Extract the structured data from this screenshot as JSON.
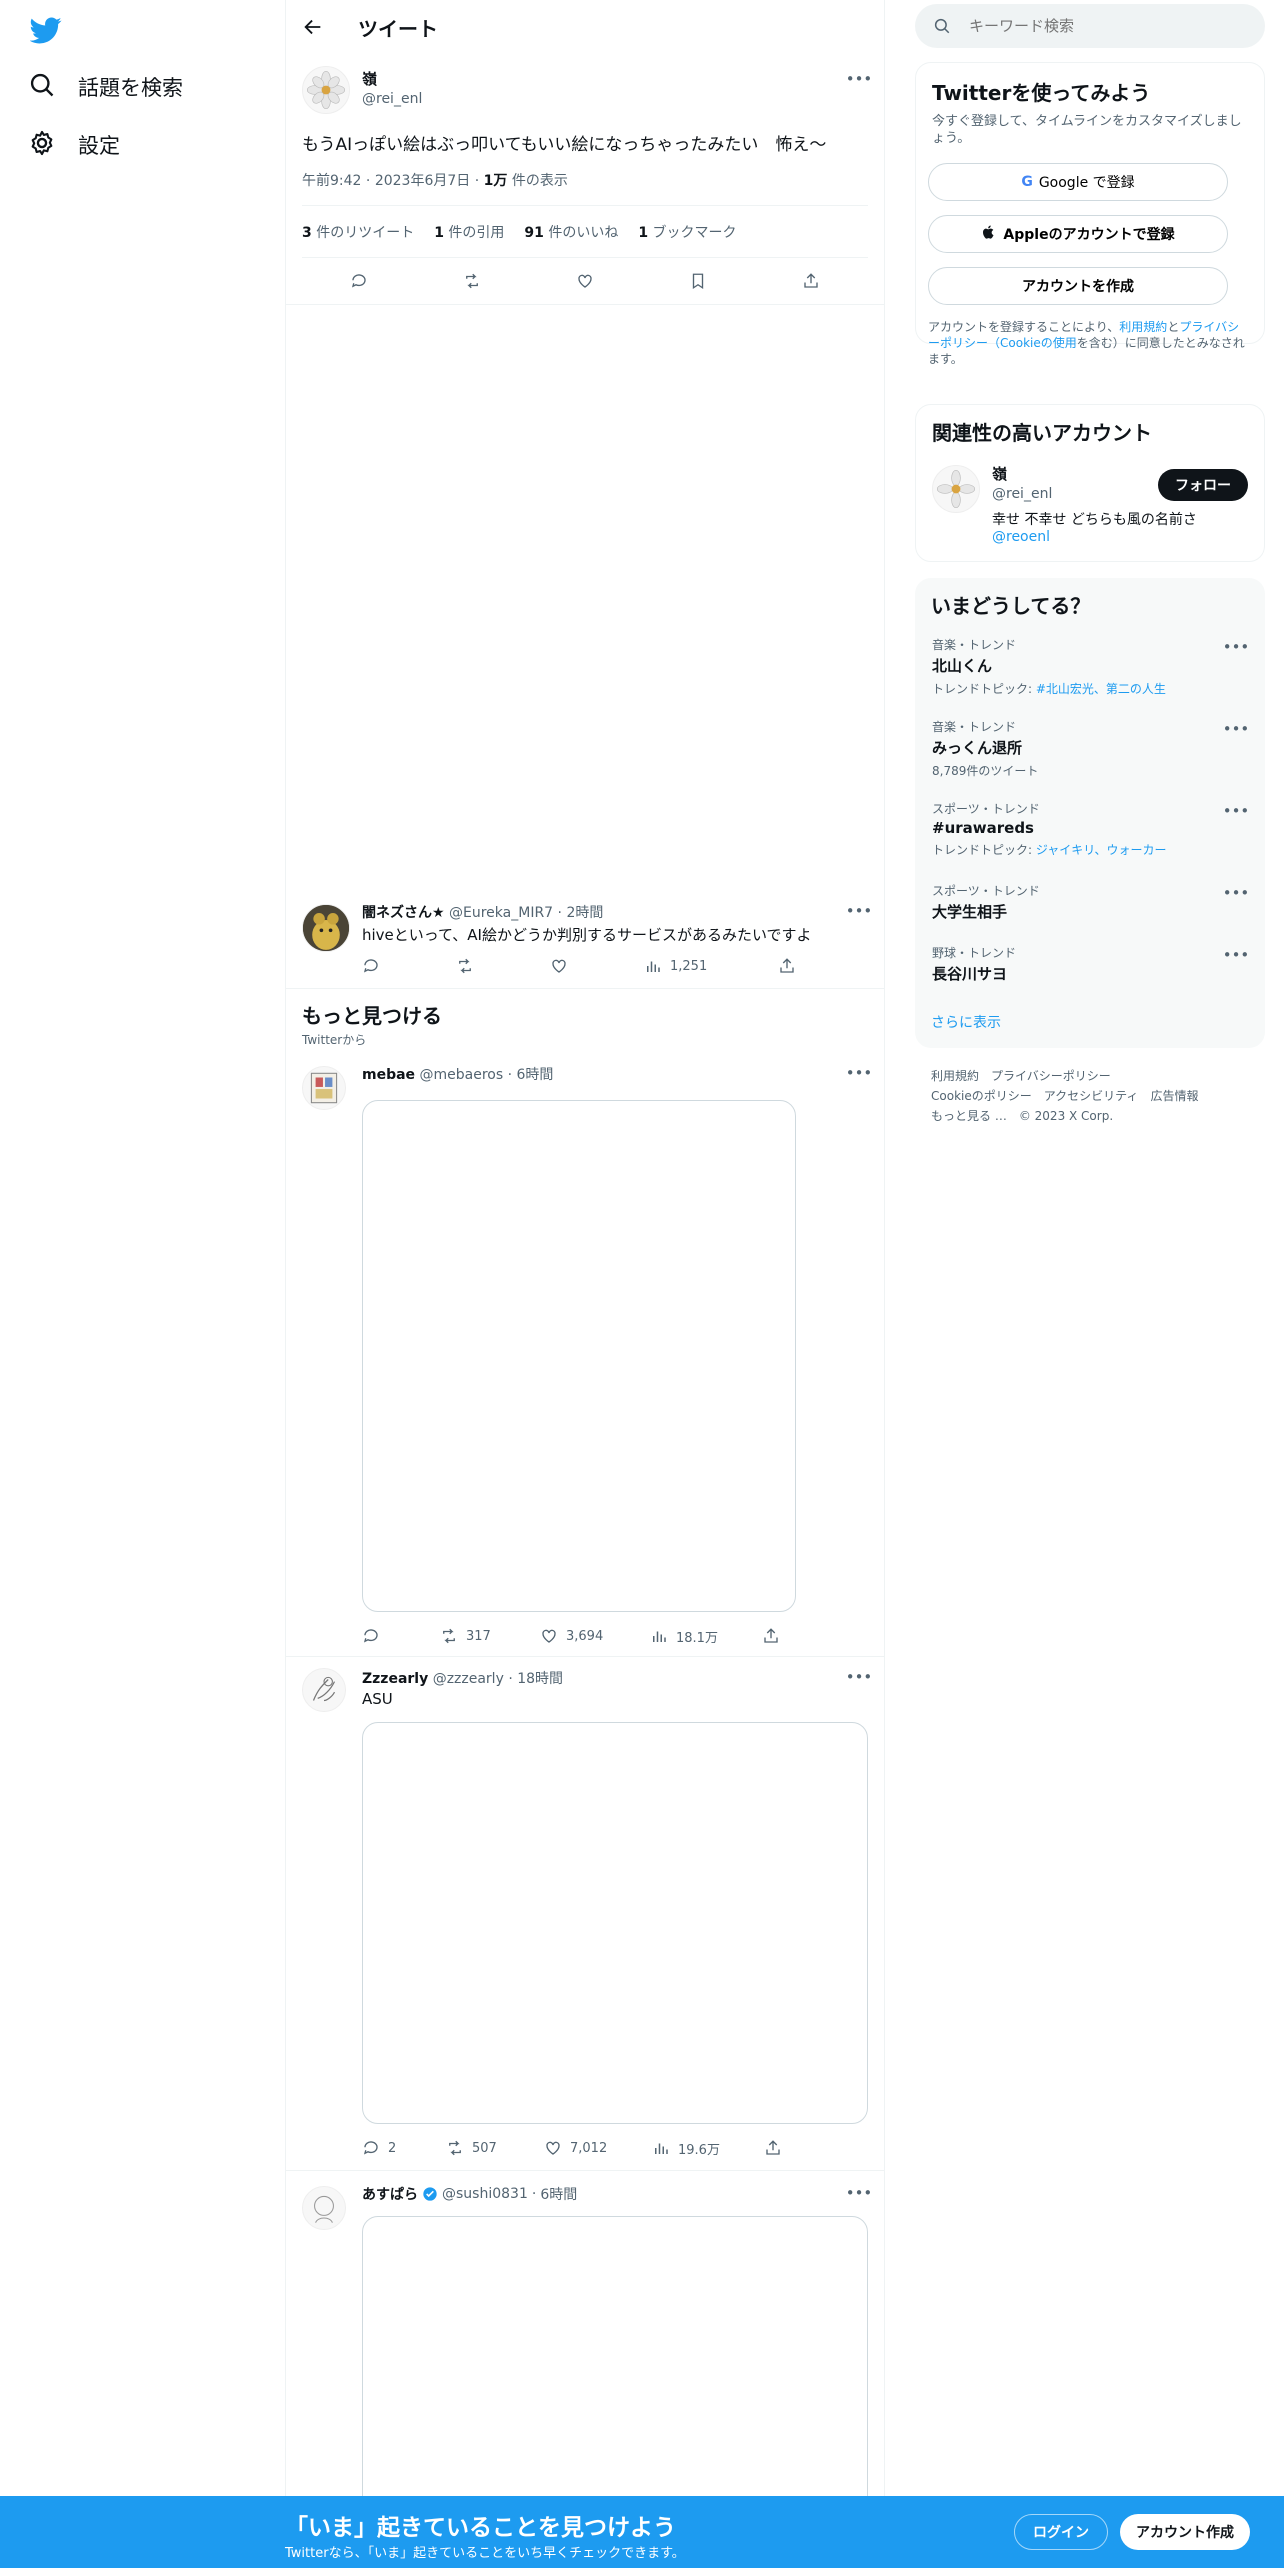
{
  "nav": {
    "explore": "話題を検索",
    "settings": "設定"
  },
  "header": {
    "title": "ツイート"
  },
  "tweet": {
    "name": "嶺",
    "handle": "@rei_enl",
    "text": "もうAIっぽい絵はぶっ叩いてもいい絵になっちゃったみたい　怖え〜",
    "time": "午前9:42",
    "date": "2023年6月7日",
    "views_num": "1万",
    "views_label": "件の表示",
    "stats": [
      {
        "num": "3",
        "label": "件のリツイート"
      },
      {
        "num": "1",
        "label": "件の引用"
      },
      {
        "num": "91",
        "label": "件のいいね"
      },
      {
        "num": "1",
        "label": "ブックマーク"
      }
    ]
  },
  "reply": {
    "name": "闇ネズさん★",
    "handle": "@Eureka_MIR7",
    "time": "2時間",
    "text": "hiveといって、AI絵かどうか判別するサービスがあるみたいですよ",
    "views": "1,251"
  },
  "discover": {
    "title": "もっと見つける",
    "subtitle": "Twitterから"
  },
  "feed": [
    {
      "name": "mebae",
      "handle": "@mebaeros",
      "time": "6時間",
      "text": "",
      "replies": "",
      "retweets": "317",
      "likes": "3,694",
      "views": "18.1万"
    },
    {
      "name": "Zzzearly",
      "handle": "@zzzearly",
      "time": "18時間",
      "text": "ASU",
      "replies": "2",
      "retweets": "507",
      "likes": "7,012",
      "views": "19.6万"
    },
    {
      "name": "あすぱら",
      "handle": "@sushi0831",
      "time": "6時間",
      "text": ""
    }
  ],
  "search": {
    "placeholder": "キーワード検索"
  },
  "signup": {
    "title": "Twitterを使ってみよう",
    "subtitle": "今すぐ登録して、タイムラインをカスタマイズしましょう。",
    "google": "Google で登録",
    "apple": "Appleのアカウントで登録",
    "create": "アカウントを作成",
    "terms_pre": "アカウントを登録することにより、",
    "terms_link1": "利用規約",
    "terms_mid": "と",
    "terms_link2": "プライバシーポリシー（Cookieの使用",
    "terms_post": "を含む）に同意したとみなされます。"
  },
  "related": {
    "title": "関連性の高いアカウント",
    "name": "嶺",
    "handle": "@rei_enl",
    "follow": "フォロー",
    "bio": "幸せ 不幸せ どちらも風の名前さ",
    "bio_link": "@reoenl"
  },
  "trends": {
    "title": "いまどうしてる？",
    "items": [
      {
        "meta": "音楽・トレンド",
        "name": "北山くん",
        "detail_pre": "トレンドトピック: ",
        "detail_link": "#北山宏光、第二の人生"
      },
      {
        "meta": "音楽・トレンド",
        "name": "みっくん退所",
        "detail_pre": "8,789件のツイート",
        "detail_link": ""
      },
      {
        "meta": "スポーツ・トレンド",
        "name": "#urawareds",
        "detail_pre": "トレンドトピック: ",
        "detail_link": "ジャイキリ、ウォーカー"
      },
      {
        "meta": "スポーツ・トレンド",
        "name": "大学生相手",
        "detail_pre": "",
        "detail_link": ""
      },
      {
        "meta": "野球・トレンド",
        "name": "長谷川サヨ",
        "detail_pre": "",
        "detail_link": ""
      }
    ],
    "more": "さらに表示"
  },
  "links": {
    "row1": [
      "利用規約",
      "プライバシーポリシー"
    ],
    "row2": [
      "Cookieのポリシー",
      "アクセシビリティ",
      "広告情報"
    ],
    "row3": [
      "もっと見る …",
      "© 2023 X Corp."
    ]
  },
  "footer": {
    "title": "「いま」起きていることを見つけよう",
    "subtitle": "Twitterなら、「いま」起きていることをいち早くチェックできます。",
    "login": "ログイン",
    "signup": "アカウント作成"
  },
  "colors": {
    "accent": "#1d9bf0",
    "text": "#0f1419",
    "muted": "#536471"
  }
}
